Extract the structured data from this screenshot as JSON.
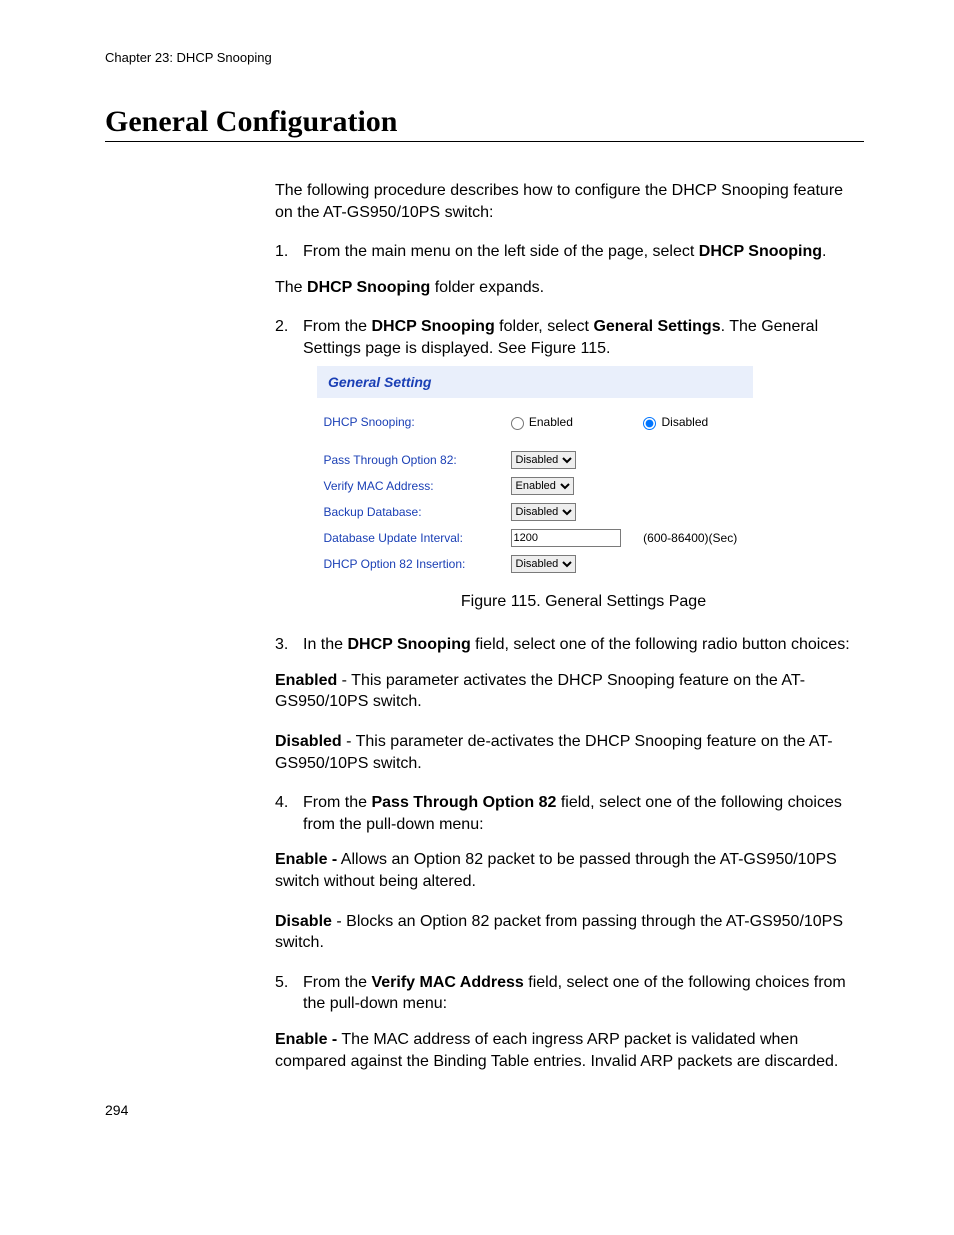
{
  "chapter_line": "Chapter 23: DHCP Snooping",
  "section_title": "General Configuration",
  "intro": "The following procedure describes how to configure the DHCP Snooping feature on the AT-GS950/10PS switch:",
  "steps": {
    "s1_pre": "From the main menu on the left side of the page, select ",
    "s1_bold": "DHCP Snooping",
    "s1_post": ".",
    "s1_line2_pre": "The ",
    "s1_line2_bold": "DHCP Snooping",
    "s1_line2_post": " folder expands.",
    "s2_pre": "From the ",
    "s2_bold1": "DHCP Snooping",
    "s2_mid": " folder, select ",
    "s2_bold2": "General Settings",
    "s2_post": ". The General Settings page is displayed. See Figure 115.",
    "s3_pre": "In the ",
    "s3_bold": "DHCP Snooping",
    "s3_post": " field, select one of the following radio button choices:",
    "s3_enabled_bold": "Enabled",
    "s3_enabled_text": " - This parameter activates the DHCP Snooping feature on the AT-GS950/10PS switch.",
    "s3_disabled_bold": "Disabled",
    "s3_disabled_text": " - This parameter de-activates the DHCP Snooping feature on the AT-GS950/10PS switch.",
    "s4_pre": "From the ",
    "s4_bold": "Pass Through Option 82",
    "s4_post": " field, select one of the following choices from the pull-down menu:",
    "s4_enable_bold": "Enable -",
    "s4_enable_text": " Allows an Option 82 packet to be passed through the AT-GS950/10PS switch without being altered.",
    "s4_disable_bold": "Disable",
    "s4_disable_text": " - Blocks an Option 82 packet from passing through the AT-GS950/10PS switch.",
    "s5_pre": "From the ",
    "s5_bold": "Verify MAC Address",
    "s5_post": " field, select one of the following choices from the pull-down menu:",
    "s5_enable_bold": "Enable -",
    "s5_enable_text": " The MAC address of each ingress ARP packet is validated when compared against the Binding Table entries. Invalid ARP packets are discarded."
  },
  "figure_caption": "Figure 115. General Settings Page",
  "ui": {
    "title": "General Setting",
    "dhcp_label": "DHCP Snooping:",
    "enabled": "Enabled",
    "disabled": "Disabled",
    "pass_label": "Pass Through Option 82:",
    "verify_label": "Verify MAC Address:",
    "backup_label": "Backup Database:",
    "interval_label": "Database Update Interval:",
    "interval_value": "1200",
    "interval_hint": "(600-86400)(Sec)",
    "insertion_label": "DHCP Option 82 Insertion:",
    "opt_disabled": "Disabled",
    "opt_enabled": "Enabled"
  },
  "page_number": "294"
}
